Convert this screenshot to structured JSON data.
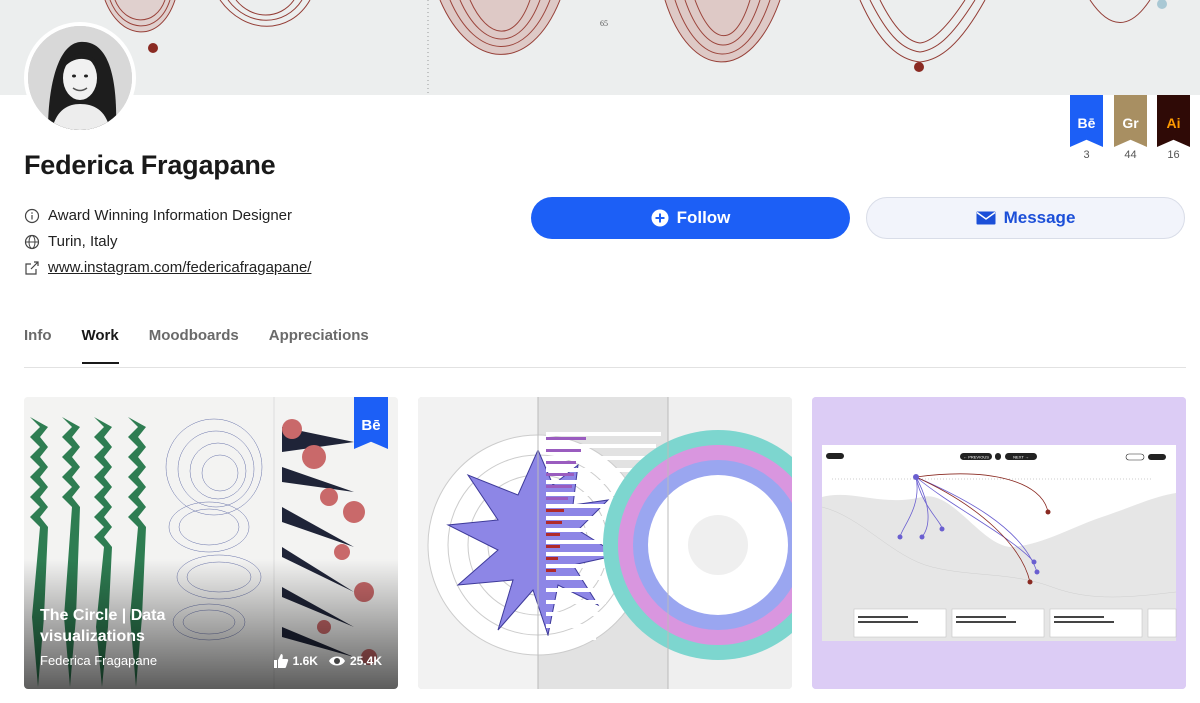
{
  "banner": {
    "number_label": "65"
  },
  "profile": {
    "name": "Federica Fragapane",
    "occupation": "Award Winning Information Designer",
    "location": "Turin, Italy",
    "website": "www.instagram.com/federicafragapane/"
  },
  "actions": {
    "follow_label": "Follow",
    "message_label": "Message"
  },
  "badges": [
    {
      "label": "Bē",
      "count": "3",
      "color": "#1c5ff6",
      "text_color": "#ffffff"
    },
    {
      "label": "Gr",
      "count": "44",
      "color": "#a88f62",
      "text_color": "#ffffff"
    },
    {
      "label": "Ai",
      "count": "16",
      "color": "#2f0a06",
      "text_color": "#ff9a00"
    }
  ],
  "tabs": [
    {
      "label": "Info"
    },
    {
      "label": "Work"
    },
    {
      "label": "Moodboards"
    },
    {
      "label": "Appreciations"
    }
  ],
  "projects": [
    {
      "title": "The Circle | Data visualizations",
      "owner": "Federica Fragapane",
      "likes": "1.6K",
      "views": "25.4K",
      "badge": "Bē"
    },
    {
      "title": "",
      "owner": "",
      "likes": "",
      "views": ""
    },
    {
      "title": "",
      "owner": "",
      "likes": "",
      "views": ""
    }
  ],
  "card3_map": {
    "previous_label": "← PREVIOUS",
    "next_label": "NEXT →"
  },
  "colors": {
    "accent": "#1c5ff6",
    "text": "#191919",
    "muted": "#6a6a6a"
  }
}
